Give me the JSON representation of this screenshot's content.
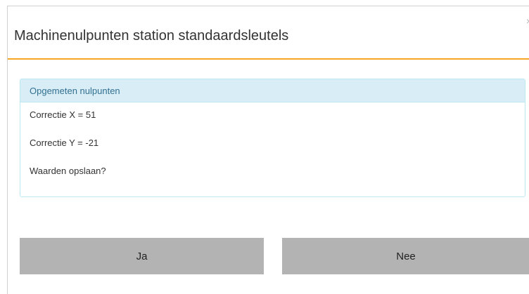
{
  "dialog": {
    "title": "Machinenulpunten station standaardsleutels",
    "close_glyph": "×",
    "panel": {
      "heading": "Opgemeten nulpunten",
      "lines": [
        "Correctie X = 51",
        "Correctie Y = -21",
        "Waarden opslaan?"
      ]
    },
    "buttons": {
      "yes_label": "Ja",
      "no_label": "Nee"
    }
  },
  "colors": {
    "accent": "#f5a623",
    "panel_heading_bg": "#d9edf7",
    "panel_border": "#bce8f1",
    "panel_heading_text": "#31708f",
    "button_bg": "#b3b3b3"
  }
}
